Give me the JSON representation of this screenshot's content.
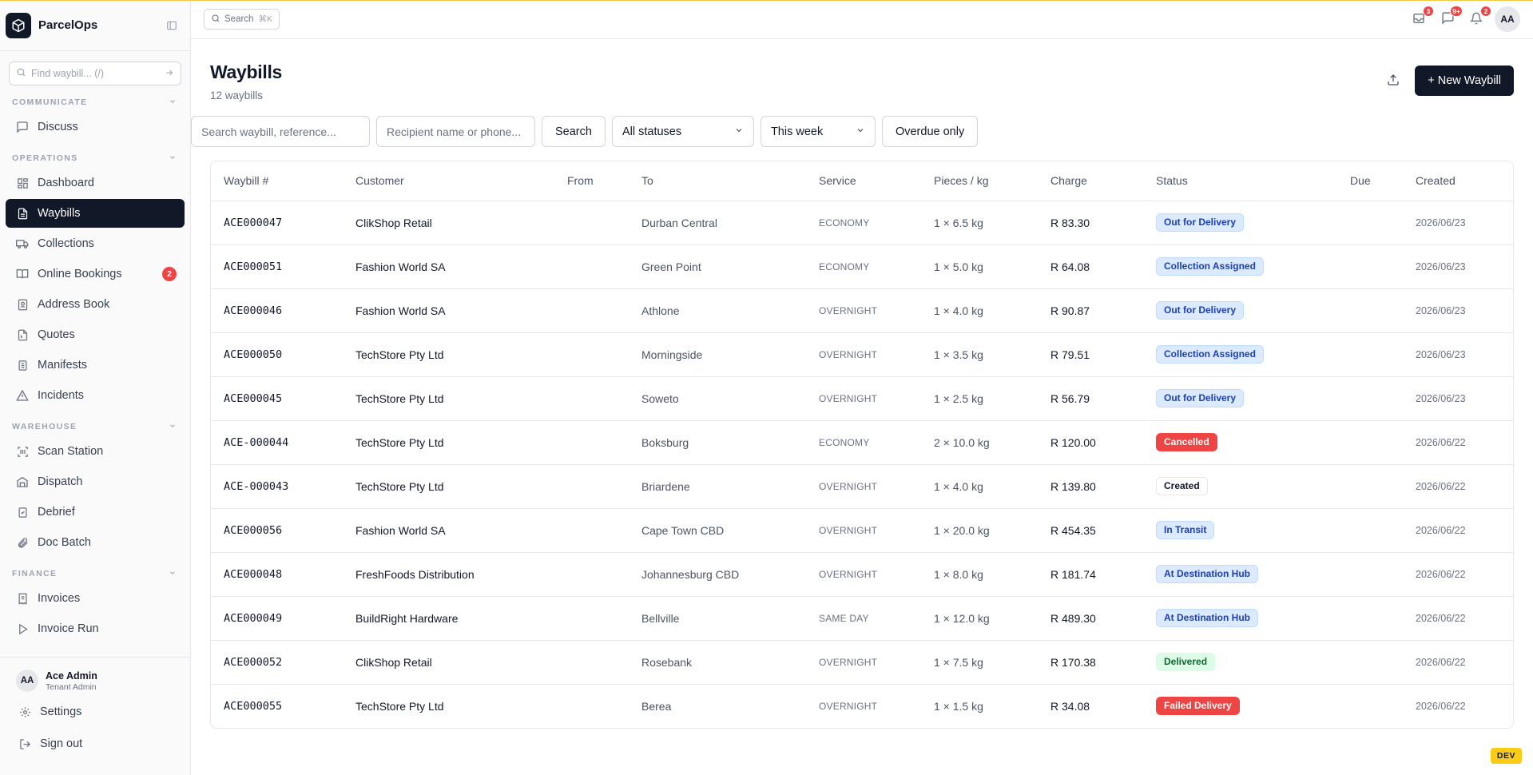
{
  "app": {
    "name": "ParcelOps"
  },
  "sidebar": {
    "search_placeholder": "Find waybill... (/)",
    "sections": {
      "communicate": {
        "title": "COMMUNICATE",
        "items": [
          {
            "label": "Discuss"
          }
        ]
      },
      "operations": {
        "title": "OPERATIONS",
        "items": [
          {
            "label": "Dashboard"
          },
          {
            "label": "Waybills"
          },
          {
            "label": "Collections"
          },
          {
            "label": "Online Bookings",
            "badge": "2"
          },
          {
            "label": "Address Book"
          },
          {
            "label": "Quotes"
          },
          {
            "label": "Manifests"
          },
          {
            "label": "Incidents"
          }
        ]
      },
      "warehouse": {
        "title": "WAREHOUSE",
        "items": [
          {
            "label": "Scan Station"
          },
          {
            "label": "Dispatch"
          },
          {
            "label": "Debrief"
          },
          {
            "label": "Doc Batch"
          }
        ]
      },
      "finance": {
        "title": "FINANCE",
        "items": [
          {
            "label": "Invoices"
          },
          {
            "label": "Invoice Run"
          }
        ]
      }
    },
    "user": {
      "initials": "AA",
      "name": "Ace Admin",
      "role": "Tenant Admin"
    },
    "footer": {
      "settings": "Settings",
      "signout": "Sign out"
    }
  },
  "topbar": {
    "search_label": "Search",
    "search_kbd": "⌘K",
    "badges": {
      "inbox": "3",
      "messages": "9+",
      "notifications": "2"
    },
    "avatar_initials": "AA"
  },
  "page": {
    "title": "Waybills",
    "subtitle": "12 waybills",
    "new_button": "+ New Waybill"
  },
  "filters": {
    "search_placeholder": "Search waybill, reference...",
    "recipient_placeholder": "Recipient name or phone...",
    "search_button": "Search",
    "status_select": "All statuses",
    "period_select": "This week",
    "overdue_button": "Overdue only"
  },
  "table": {
    "columns": [
      "Waybill #",
      "Customer",
      "From",
      "To",
      "Service",
      "Pieces / kg",
      "Charge",
      "Status",
      "Due",
      "Created"
    ],
    "rows": [
      {
        "waybill": "ACE000047",
        "customer": "ClikShop Retail",
        "from": "",
        "to": "Durban Central",
        "service": "ECONOMY",
        "pieces": "1 × 6.5 kg",
        "charge": "R 83.30",
        "status": "Out for Delivery",
        "status_style": "blue",
        "due": "",
        "created": "2026/06/23"
      },
      {
        "waybill": "ACE000051",
        "customer": "Fashion World SA",
        "from": "",
        "to": "Green Point",
        "service": "ECONOMY",
        "pieces": "1 × 5.0 kg",
        "charge": "R 64.08",
        "status": "Collection Assigned",
        "status_style": "blue",
        "due": "",
        "created": "2026/06/23"
      },
      {
        "waybill": "ACE000046",
        "customer": "Fashion World SA",
        "from": "",
        "to": "Athlone",
        "service": "OVERNIGHT",
        "pieces": "1 × 4.0 kg",
        "charge": "R 90.87",
        "status": "Out for Delivery",
        "status_style": "blue",
        "due": "",
        "created": "2026/06/23"
      },
      {
        "waybill": "ACE000050",
        "customer": "TechStore Pty Ltd",
        "from": "",
        "to": "Morningside",
        "service": "OVERNIGHT",
        "pieces": "1 × 3.5 kg",
        "charge": "R 79.51",
        "status": "Collection Assigned",
        "status_style": "blue",
        "due": "",
        "created": "2026/06/23"
      },
      {
        "waybill": "ACE000045",
        "customer": "TechStore Pty Ltd",
        "from": "",
        "to": "Soweto",
        "service": "OVERNIGHT",
        "pieces": "1 × 2.5 kg",
        "charge": "R 56.79",
        "status": "Out for Delivery",
        "status_style": "blue",
        "due": "",
        "created": "2026/06/23"
      },
      {
        "waybill": "ACE-000044",
        "customer": "TechStore Pty Ltd",
        "from": "",
        "to": "Boksburg",
        "service": "ECONOMY",
        "pieces": "2 × 10.0 kg",
        "charge": "R 120.00",
        "status": "Cancelled",
        "status_style": "red",
        "due": "",
        "created": "2026/06/22"
      },
      {
        "waybill": "ACE-000043",
        "customer": "TechStore Pty Ltd",
        "from": "",
        "to": "Briardene",
        "service": "OVERNIGHT",
        "pieces": "1 × 4.0 kg",
        "charge": "R 139.80",
        "status": "Created",
        "status_style": "plain",
        "due": "",
        "created": "2026/06/22"
      },
      {
        "waybill": "ACE000056",
        "customer": "Fashion World SA",
        "from": "",
        "to": "Cape Town CBD",
        "service": "OVERNIGHT",
        "pieces": "1 × 20.0 kg",
        "charge": "R 454.35",
        "status": "In Transit",
        "status_style": "blue",
        "due": "",
        "created": "2026/06/22"
      },
      {
        "waybill": "ACE000048",
        "customer": "FreshFoods Distribution",
        "from": "",
        "to": "Johannesburg CBD",
        "service": "OVERNIGHT",
        "pieces": "1 × 8.0 kg",
        "charge": "R 181.74",
        "status": "At Destination Hub",
        "status_style": "blue",
        "due": "",
        "created": "2026/06/22"
      },
      {
        "waybill": "ACE000049",
        "customer": "BuildRight Hardware",
        "from": "",
        "to": "Bellville",
        "service": "SAME DAY",
        "pieces": "1 × 12.0 kg",
        "charge": "R 489.30",
        "status": "At Destination Hub",
        "status_style": "blue",
        "due": "",
        "created": "2026/06/22"
      },
      {
        "waybill": "ACE000052",
        "customer": "ClikShop Retail",
        "from": "",
        "to": "Rosebank",
        "service": "OVERNIGHT",
        "pieces": "1 × 7.5 kg",
        "charge": "R 170.38",
        "status": "Delivered",
        "status_style": "green",
        "due": "",
        "created": "2026/06/22"
      },
      {
        "waybill": "ACE000055",
        "customer": "TechStore Pty Ltd",
        "from": "",
        "to": "Berea",
        "service": "OVERNIGHT",
        "pieces": "1 × 1.5 kg",
        "charge": "R 34.08",
        "status": "Failed Delivery",
        "status_style": "red",
        "due": "",
        "created": "2026/06/22"
      }
    ]
  },
  "env_badge": "DEV"
}
